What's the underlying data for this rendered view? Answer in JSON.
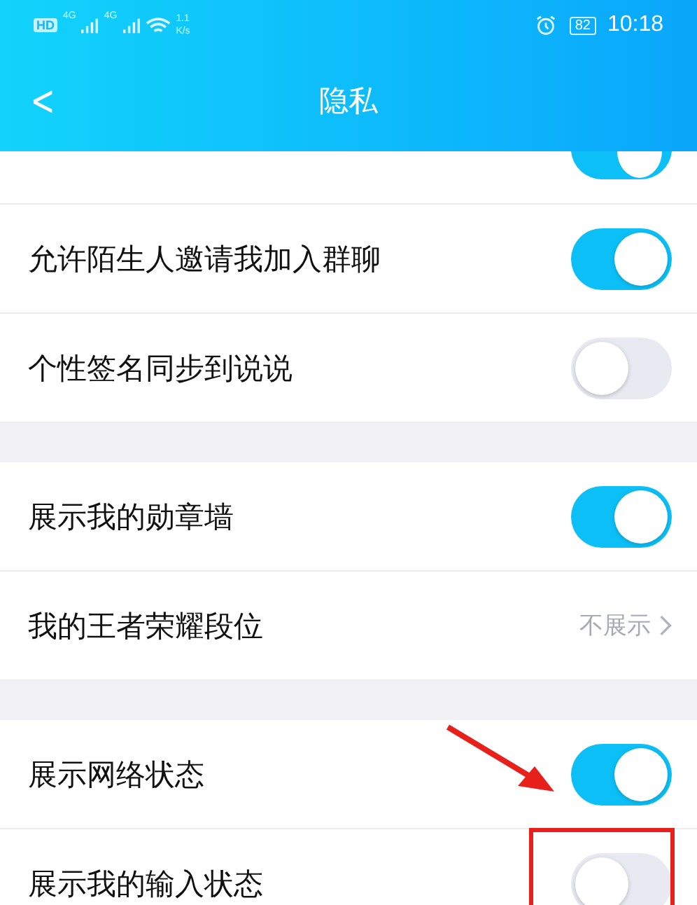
{
  "status_bar": {
    "hd": "HD",
    "sim1": "4G",
    "sim2": "4G",
    "speed_value": "1.1",
    "speed_unit": "K/s",
    "battery": "82",
    "time": "10:18"
  },
  "header": {
    "back": "<",
    "title": "隐私"
  },
  "sections": [
    {
      "items": [
        {
          "kind": "toggle_stub",
          "on": true
        },
        {
          "kind": "toggle",
          "label": "允许陌生人邀请我加入群聊",
          "on": true
        },
        {
          "kind": "toggle",
          "label": "个性签名同步到说说",
          "on": false
        }
      ]
    },
    {
      "items": [
        {
          "kind": "toggle",
          "label": "展示我的勋章墙",
          "on": true
        },
        {
          "kind": "value",
          "label": "我的王者荣耀段位",
          "value": "不展示"
        }
      ]
    },
    {
      "items": [
        {
          "kind": "toggle",
          "label": "展示网络状态",
          "on": true
        },
        {
          "kind": "toggle",
          "label": "展示我的输入状态",
          "on": false,
          "highlighted": true
        }
      ]
    }
  ]
}
